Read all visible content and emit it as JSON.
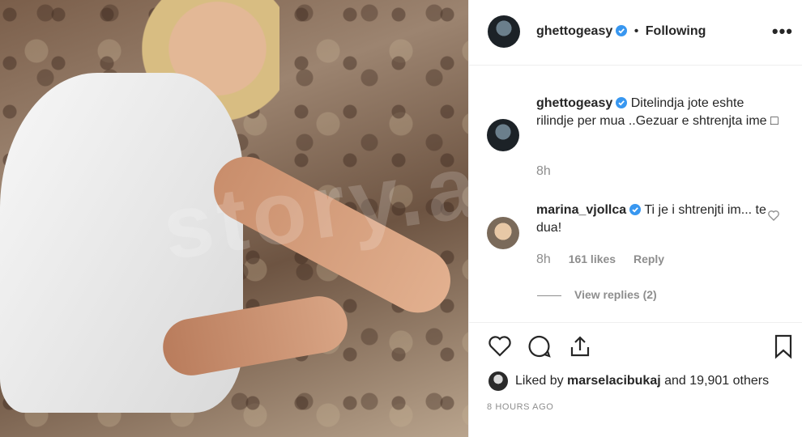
{
  "post": {
    "username": "ghettogeasy",
    "follow_status": "Following",
    "separator": "•",
    "more": "•••"
  },
  "caption": {
    "username": "ghettogeasy",
    "text": "Ditelindja jote eshte rilindje per mua ..Gezuar e shtrenjta ime □",
    "age": "8h"
  },
  "comment": {
    "username": "marina_vjollca",
    "text": "Ti je i shtrenjti im... te dua!",
    "age": "8h",
    "likes": "161 likes",
    "reply": "Reply",
    "view_replies": "View replies (2)"
  },
  "engagement": {
    "liked_by_prefix": "Liked by",
    "liked_by_user": "marselacibukaj",
    "liked_by_suffix": "and 19,901 others",
    "timestamp": "8 HOURS AGO"
  },
  "photo": {
    "watermark": "story.al"
  },
  "colors": {
    "verified": "#3897f0",
    "text": "#262626",
    "muted": "#8e8e8e"
  }
}
